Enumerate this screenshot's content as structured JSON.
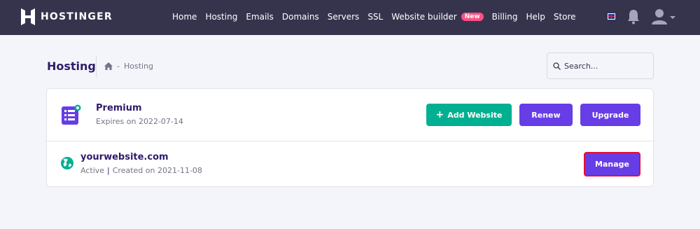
{
  "brand": {
    "name": "HOSTINGER"
  },
  "nav": {
    "items": [
      {
        "label": "Home"
      },
      {
        "label": "Hosting"
      },
      {
        "label": "Emails"
      },
      {
        "label": "Domains"
      },
      {
        "label": "Servers"
      },
      {
        "label": "SSL"
      },
      {
        "label": "Website builder",
        "badge": "New"
      },
      {
        "label": "Billing"
      },
      {
        "label": "Help"
      },
      {
        "label": "Store"
      }
    ]
  },
  "header_icons": [
    "uk-flag-icon",
    "bell-icon",
    "user-avatar-icon",
    "chevron-down-icon"
  ],
  "page": {
    "title": "Hosting",
    "breadcrumb": {
      "home_icon": "home-icon",
      "separator": "-",
      "current": "Hosting"
    },
    "search": {
      "placeholder": "Search..."
    }
  },
  "plan": {
    "icon": "server-plan-icon",
    "name": "Premium",
    "expires": "Expires on 2022-07-14",
    "buttons": {
      "add_website": "Add Website",
      "renew": "Renew",
      "upgrade": "Upgrade"
    }
  },
  "website": {
    "icon": "globe-icon",
    "domain": "yourwebsite.com",
    "status": "Active",
    "created": "Created on 2021-11-08",
    "manage_label": "Manage"
  },
  "colors": {
    "topbar": "#36344d",
    "primary": "#673de6",
    "success": "#00b090",
    "badge": "#fc5185",
    "highlight_border": "#e0103a"
  }
}
